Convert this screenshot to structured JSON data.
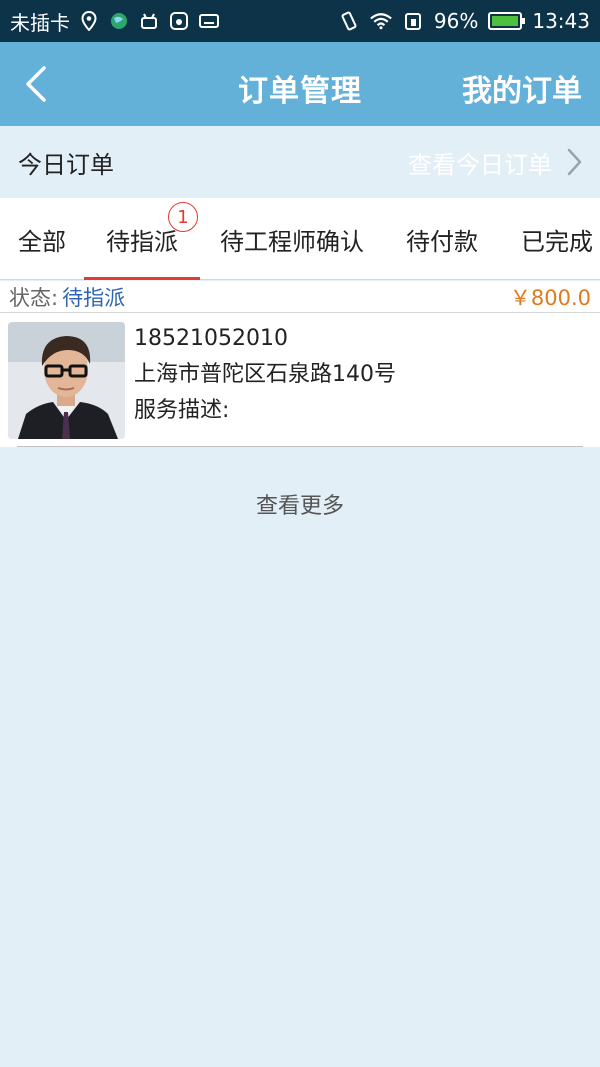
{
  "status_bar": {
    "carrier": "未插卡",
    "battery_percent": "96%",
    "time": "13:43"
  },
  "header": {
    "title": "订单管理",
    "action_label": "我的订单"
  },
  "today": {
    "label": "今日订单",
    "link_label": "查看今日订单"
  },
  "tabs": [
    {
      "label": "全部"
    },
    {
      "label": "待指派",
      "badge": "1"
    },
    {
      "label": "待工程师确认"
    },
    {
      "label": "待付款"
    },
    {
      "label": "已完成"
    }
  ],
  "order": {
    "status_label": "状态:",
    "status_value": "待指派",
    "price": "￥800.0",
    "phone": "18521052010",
    "address": "上海市普陀区石泉路140号",
    "description_label": "服务描述:"
  },
  "more_label": "查看更多",
  "colors": {
    "header": "#63b0d8",
    "background": "#e3eff7",
    "active_tab_indicator": "#e23b2f",
    "status_value": "#2f64b7",
    "price": "#e07a1f"
  }
}
